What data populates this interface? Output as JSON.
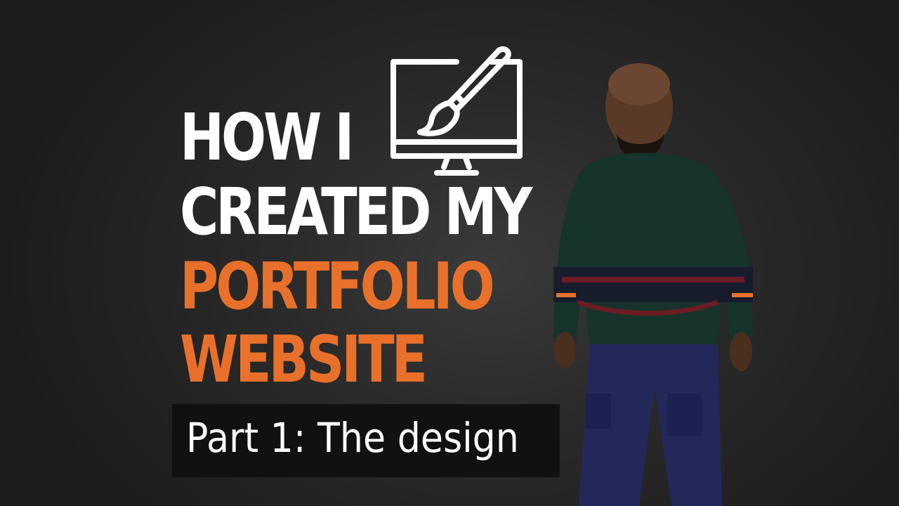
{
  "headline": {
    "line1": "HOW I",
    "line2": "CREATED MY",
    "line3": "PORTFOLIO",
    "line4": "WEBSITE"
  },
  "subtitle": "Part 1: The design",
  "colors": {
    "background": "#1f1f1f",
    "text_white": "#ffffff",
    "accent_orange": "#e8702a",
    "subtitle_box": "#111111"
  },
  "icons": {
    "monitor": "monitor-paintbrush-icon"
  }
}
